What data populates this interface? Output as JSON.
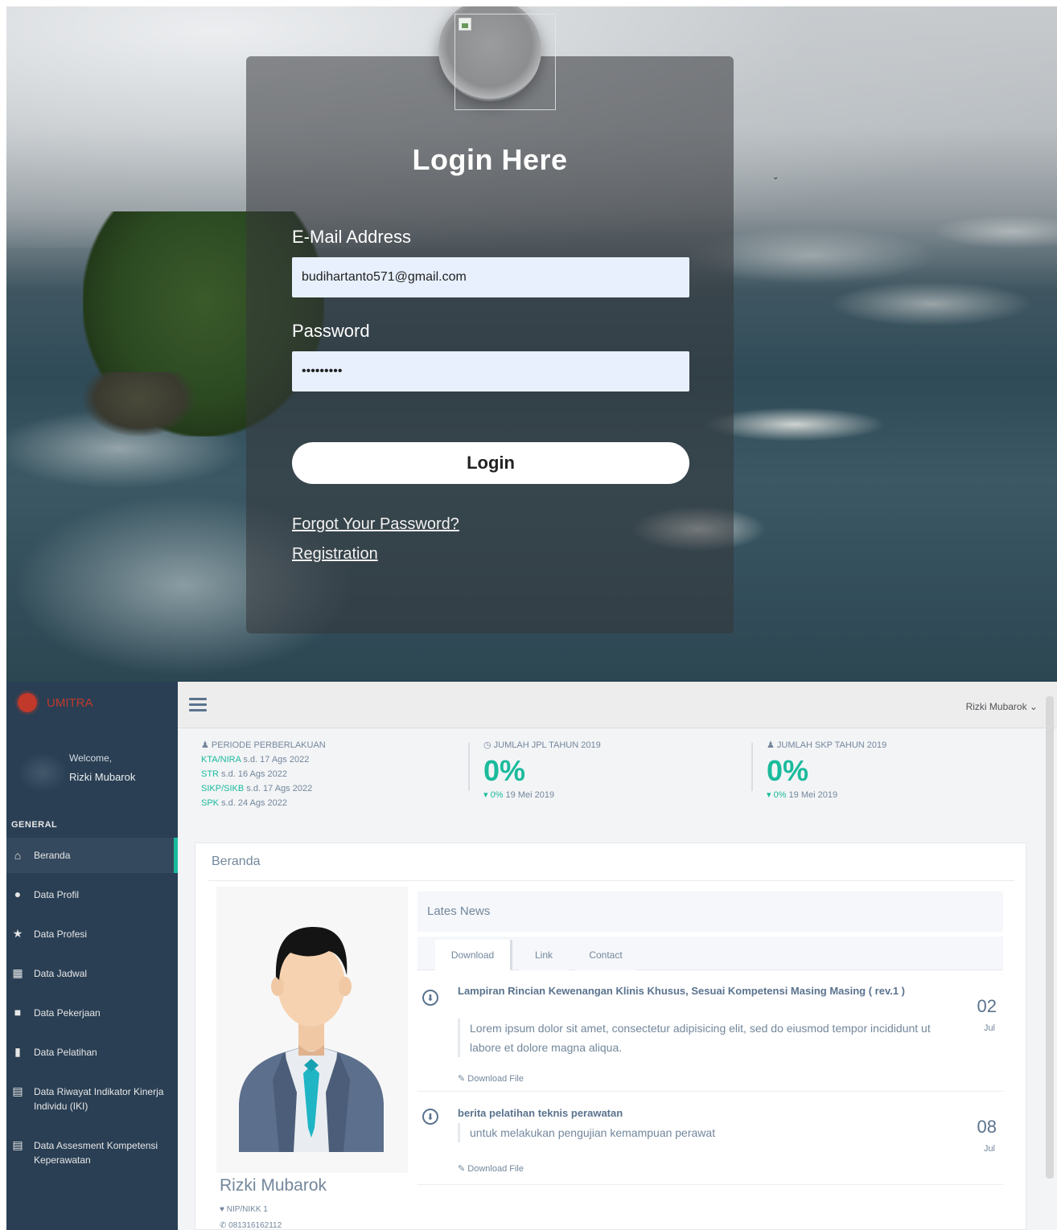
{
  "login": {
    "title": "Login Here",
    "email_label": "E-Mail Address",
    "email_value": "budihartanto571@gmail.com",
    "password_label": "Password",
    "password_value": "•••••••••",
    "login_button": "Login",
    "forgot_link": "Forgot Your Password?",
    "register_link": "Registration",
    "panel_color": "#34363a",
    "input_bg": "#e8f0fe"
  },
  "dashboard": {
    "brand": "UMITRA",
    "user_menu": "Rizki Mubarok ⌄",
    "welcome": "Welcome,",
    "welcome_name": "Rizki Mubarok",
    "menu_section": "GENERAL",
    "menu": [
      {
        "label": "Beranda",
        "icon": "home-icon",
        "glyph": "⌂"
      },
      {
        "label": "Data Profil",
        "icon": "user-icon",
        "glyph": "●"
      },
      {
        "label": "Data Profesi",
        "icon": "star-icon",
        "glyph": "★"
      },
      {
        "label": "Data Jadwal",
        "icon": "calendar-icon",
        "glyph": "▦"
      },
      {
        "label": "Data Pekerjaan",
        "icon": "briefcase-icon",
        "glyph": "■"
      },
      {
        "label": "Data Pelatihan",
        "icon": "bookmark-icon",
        "glyph": "▮"
      },
      {
        "label": "Data Riwayat Indikator Kinerja Individu (IKI)",
        "icon": "file-icon",
        "glyph": "▤"
      },
      {
        "label": "Data Assesment Kompetensi Keperawatan",
        "icon": "file-text-icon",
        "glyph": "▤"
      }
    ],
    "tiles": {
      "periode": {
        "head": "♟ PERIODE PERBERLAKUAN",
        "lines": [
          {
            "key": "KTA/NIRA",
            "text": " s.d. 17 Ags 2022"
          },
          {
            "key": "STR",
            "text": " s.d. 16 Ags 2022"
          },
          {
            "key": "SIKP/SIKB",
            "text": " s.d. 17 Ags 2022"
          },
          {
            "key": "SPK",
            "text": " s.d. 24 Ags 2022"
          }
        ]
      },
      "jpl": {
        "head": "◷ JUMLAH JPL TAHUN 2019",
        "value": "0%",
        "sub_green": "▾ 0%",
        "sub": " 19 Mei 2019"
      },
      "skp": {
        "head": "♟ JUMLAH SKP TAHUN 2019",
        "value": "0%",
        "sub_green": "▾ 0%",
        "sub": " 19 Mei 2019"
      }
    },
    "panel_title": "Beranda",
    "profile": {
      "name": "Rizki Mubarok",
      "nip": "♥ NIP/NIKK 1",
      "phone": "✆ 081316162112"
    },
    "news": {
      "title": "Lates News",
      "tabs": [
        "Download",
        "Link",
        "Contact"
      ],
      "items": [
        {
          "heading": "Lampiran Rincian Kewenangan Klinis Khusus, Sesuai Kompetensi Masing Masing ( rev.1 )",
          "excerpt": "Lorem ipsum dolor sit amet, consectetur adipisicing elit, sed do eiusmod tempor incididunt ut labore et dolore magna aliqua.",
          "file": "✎ Download File",
          "day": "02",
          "month": "Jul"
        },
        {
          "heading": "berita pelatihan teknis perawatan",
          "excerpt": "untuk melakukan pengujian kemampuan perawat",
          "file": "✎ Download File",
          "day": "08",
          "month": "Jul"
        }
      ]
    },
    "accent_color": "#1abb9c",
    "sidebar_color": "#2a3f54"
  }
}
